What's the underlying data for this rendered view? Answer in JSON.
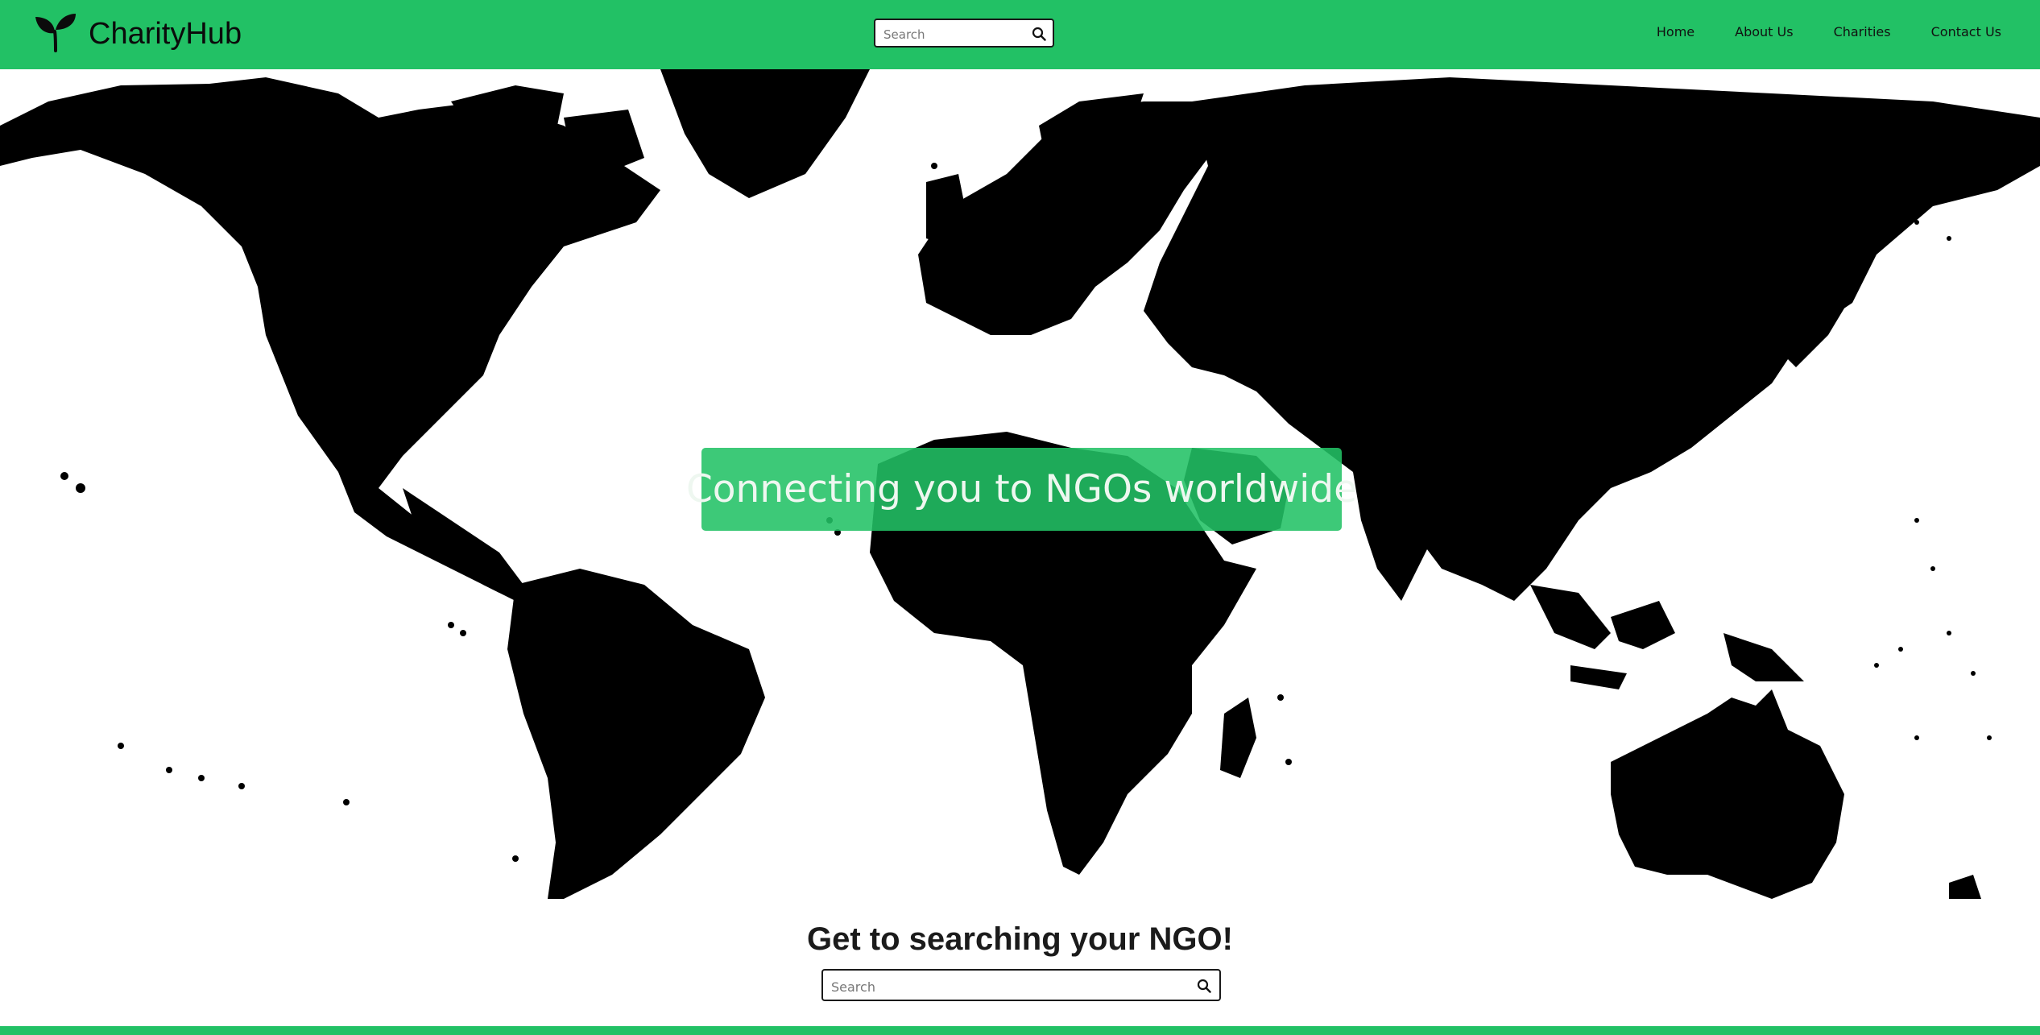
{
  "brand": {
    "name": "CharityHub",
    "logo_icon": "sprout-icon",
    "accent_color": "#22c165"
  },
  "header_search": {
    "placeholder": "Search",
    "icon": "search-icon"
  },
  "nav": {
    "items": [
      {
        "label": "Home"
      },
      {
        "label": "About Us"
      },
      {
        "label": "Charities"
      },
      {
        "label": "Contact Us"
      }
    ]
  },
  "hero": {
    "tagline": "Connecting you to NGOs worldwide",
    "background": "world-map-silhouette"
  },
  "cta": {
    "heading": "Get to searching your NGO!",
    "search_placeholder": "Search",
    "icon": "search-icon"
  }
}
